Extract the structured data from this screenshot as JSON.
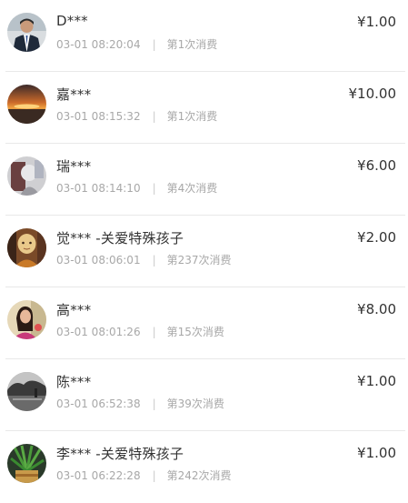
{
  "entries": [
    {
      "name": "D***",
      "time": "03-01 08:20:04",
      "visits": "第1次消费",
      "amount": "¥1.00",
      "avatar_icon": "man-in-suit-avatar"
    },
    {
      "name": "嘉***",
      "time": "03-01 08:15:32",
      "visits": "第1次消费",
      "amount": "¥10.00",
      "avatar_icon": "sunset-avatar"
    },
    {
      "name": "瑞***",
      "time": "03-01 08:14:10",
      "visits": "第4次消费",
      "amount": "¥6.00",
      "avatar_icon": "grey-figure-avatar"
    },
    {
      "name": "觉*** -关爱特殊孩子",
      "time": "03-01 08:06:01",
      "visits": "第237次消费",
      "amount": "¥2.00",
      "avatar_icon": "monk-avatar"
    },
    {
      "name": "高***",
      "time": "03-01 08:01:26",
      "visits": "第15次消费",
      "amount": "¥8.00",
      "avatar_icon": "woman-avatar"
    },
    {
      "name": "陈***",
      "time": "03-01 06:52:38",
      "visits": "第39次消费",
      "amount": "¥1.00",
      "avatar_icon": "landscape-bw-avatar"
    },
    {
      "name": "李*** -关爱特殊孩子",
      "time": "03-01 06:22:28",
      "visits": "第242次消费",
      "amount": "¥1.00",
      "avatar_icon": "plant-avatar"
    }
  ],
  "separator": "|"
}
